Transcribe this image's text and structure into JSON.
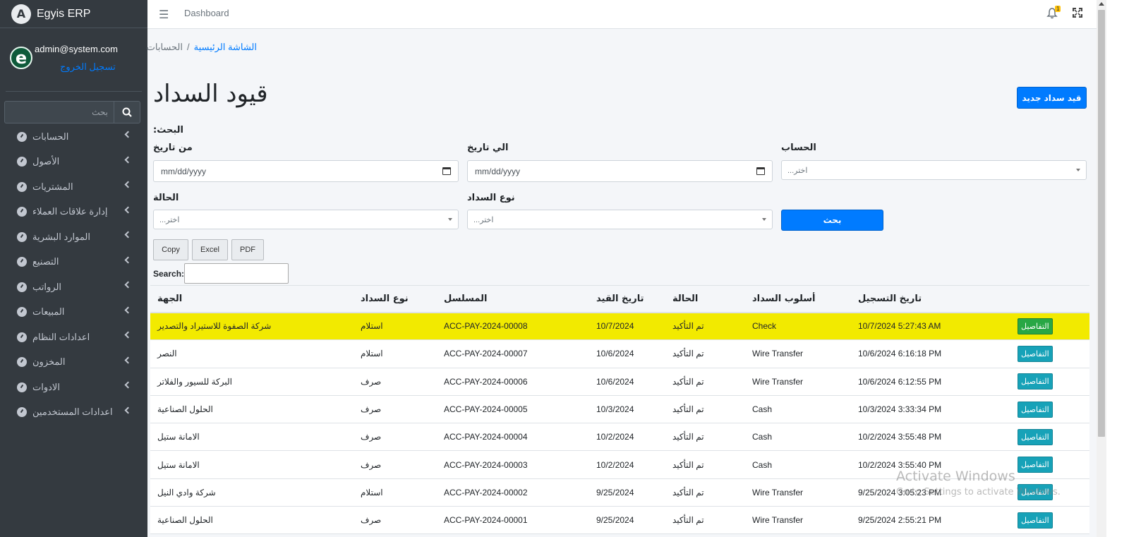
{
  "app": {
    "title": "Egyis ERP"
  },
  "user": {
    "email": "admin@system.com",
    "logout": "تسجيل الخروج"
  },
  "sidebar": {
    "search_placeholder": "بحث",
    "items": [
      {
        "label": "الحسابات"
      },
      {
        "label": "الأصول"
      },
      {
        "label": "المشتريات"
      },
      {
        "label": "إدارة علاقات العملاء"
      },
      {
        "label": "الموارد البشرية"
      },
      {
        "label": "التصنيع"
      },
      {
        "label": "الرواتب"
      },
      {
        "label": "المبيعات"
      },
      {
        "label": "اعدادات النظام"
      },
      {
        "label": "المخزون"
      },
      {
        "label": "الادوات"
      },
      {
        "label": "اعدادات المستخدمين"
      }
    ]
  },
  "topbar": {
    "link": "Dashboard",
    "notifications_count": "1"
  },
  "breadcrumb": {
    "home": "الشاشة الرئيسية",
    "separator": "/",
    "current": "الحسابات"
  },
  "page": {
    "title": "قيود السداد",
    "new_button": "قيد سداد جديد"
  },
  "filters": {
    "heading": ":البحث",
    "from_date_label": "من تاريخ",
    "to_date_label": "الي تاريخ",
    "account_label": "الحساب",
    "status_label": "الحالة",
    "payment_type_label": "نوع السداد",
    "date_placeholder": "mm/dd/yyyy",
    "select_placeholder": "...اختر",
    "search_button": "بحث"
  },
  "export": {
    "copy": "Copy",
    "excel": "Excel",
    "pdf": "PDF"
  },
  "table_search": {
    "label": "Search:"
  },
  "table": {
    "headers": {
      "party": "الجهة",
      "payment_type": "نوع السداد",
      "serial": "المسلسل",
      "entry_date": "تاريخ القيد",
      "status": "الحالة",
      "payment_method": "أسلوب السداد",
      "registration_date": "تاريخ التسجيل"
    },
    "details_label": "التفاصيل",
    "rows": [
      {
        "party": "شركة الصفوة للاستيراد والتصدير",
        "payment_type": "استلام",
        "serial": "ACC-PAY-2024-00008",
        "entry_date": "10/7/2024",
        "status": "تم التأكيد",
        "payment_method": "Check",
        "registration_date": "10/7/2024 5:27:43 AM"
      },
      {
        "party": "النصر",
        "payment_type": "استلام",
        "serial": "ACC-PAY-2024-00007",
        "entry_date": "10/6/2024",
        "status": "تم التأكيد",
        "payment_method": "Wire Transfer",
        "registration_date": "10/6/2024 6:16:18 PM"
      },
      {
        "party": "البركة للسيور والفلاتر",
        "payment_type": "صرف",
        "serial": "ACC-PAY-2024-00006",
        "entry_date": "10/6/2024",
        "status": "تم التأكيد",
        "payment_method": "Wire Transfer",
        "registration_date": "10/6/2024 6:12:55 PM"
      },
      {
        "party": "الحلول الصناعية",
        "payment_type": "صرف",
        "serial": "ACC-PAY-2024-00005",
        "entry_date": "10/3/2024",
        "status": "تم التأكيد",
        "payment_method": "Cash",
        "registration_date": "10/3/2024 3:33:34 PM"
      },
      {
        "party": "الامانة ستيل",
        "payment_type": "صرف",
        "serial": "ACC-PAY-2024-00004",
        "entry_date": "10/2/2024",
        "status": "تم التأكيد",
        "payment_method": "Cash",
        "registration_date": "10/2/2024 3:55:48 PM"
      },
      {
        "party": "الامانة ستيل",
        "payment_type": "صرف",
        "serial": "ACC-PAY-2024-00003",
        "entry_date": "10/2/2024",
        "status": "تم التأكيد",
        "payment_method": "Cash",
        "registration_date": "10/2/2024 3:55:40 PM"
      },
      {
        "party": "شركة وادي النيل",
        "payment_type": "استلام",
        "serial": "ACC-PAY-2024-00002",
        "entry_date": "9/25/2024",
        "status": "تم التأكيد",
        "payment_method": "Wire Transfer",
        "registration_date": "9/25/2024 3:05:23 PM"
      },
      {
        "party": "الحلول الصناعية",
        "payment_type": "صرف",
        "serial": "ACC-PAY-2024-00001",
        "entry_date": "9/25/2024",
        "status": "تم التأكيد",
        "payment_method": "Wire Transfer",
        "registration_date": "9/25/2024 2:55:21 PM"
      }
    ]
  },
  "watermark": {
    "line1": "Activate Windows",
    "line2": "Go to Settings to activate Windows."
  },
  "colors": {
    "sidebar_bg": "#343a40",
    "primary": "#007bff",
    "details_btn": "#17a2b8",
    "details_btn_highlight": "#28a745",
    "highlight_row": "#f2ea00"
  }
}
